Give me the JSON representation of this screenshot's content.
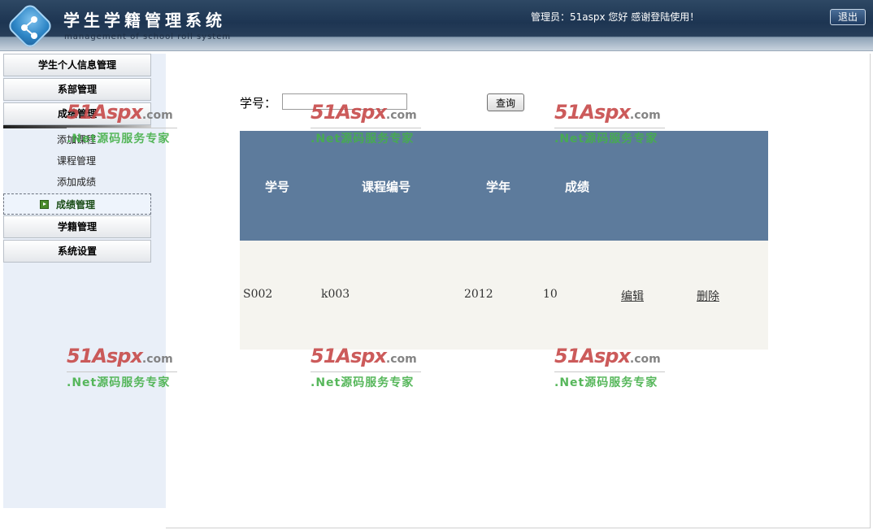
{
  "header": {
    "title": "学生学籍管理系统",
    "subtitle": "management of school roll system",
    "admin_text": "管理员：51aspx 您好 感谢登陆使用！",
    "logout_label": "退出"
  },
  "sidebar": {
    "items": [
      {
        "label": "学生个人信息管理"
      },
      {
        "label": "系部管理"
      },
      {
        "label": "成绩管理"
      },
      {
        "label": "学籍管理"
      },
      {
        "label": "系统设置"
      }
    ],
    "sub_items": [
      {
        "label": "添加课程"
      },
      {
        "label": "课程管理"
      },
      {
        "label": "添加成绩"
      },
      {
        "label": "成绩管理",
        "active": true
      }
    ]
  },
  "search": {
    "label": "学号：",
    "value": "",
    "button_label": "查询"
  },
  "table": {
    "columns": [
      "学号",
      "课程编号",
      "学年",
      "成绩"
    ],
    "rows": [
      {
        "student_id": "S002",
        "course_id": "k003",
        "year": "2012",
        "score": "10",
        "edit": "编辑",
        "delete": "删除"
      }
    ]
  },
  "watermark": {
    "brand": "51Aspx",
    "suffix": ".com",
    "tagline": ".Net源码服务专家"
  },
  "colors": {
    "header_bg": "#1d3552",
    "grid_header": "#5d7b9c",
    "grid_row": "#f5f4ef",
    "sidebar_bg": "#e9eff8",
    "watermark_red": "#c74a4a",
    "watermark_green": "#45b04a"
  }
}
